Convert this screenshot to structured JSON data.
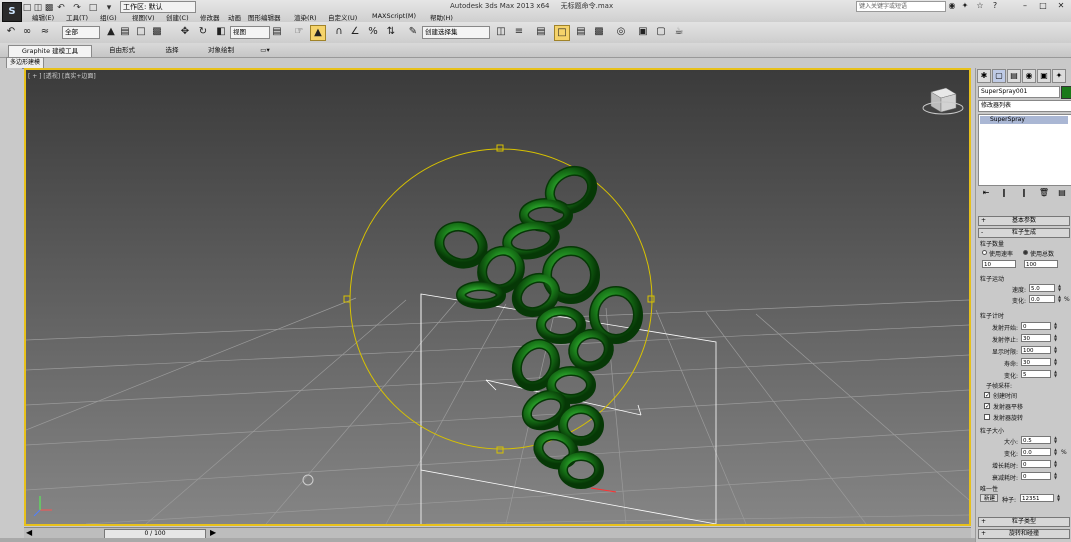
{
  "window": {
    "title": "Autodesk 3ds Max  2013 x64",
    "filename": "无标题命令.max",
    "workspace": "工作区: 默认",
    "search_placeholder": "键入关键字或短语"
  },
  "menu": [
    "编辑(E)",
    "工具(T)",
    "组(G)",
    "视图(V)",
    "创建(C)",
    "修改器",
    "动画",
    "图形编辑器",
    "渲染(R)",
    "自定义(U)",
    "MAXScript(M)",
    "帮助(H)"
  ],
  "toolbar": {
    "filter_dropdown": "全部",
    "coord_dropdown": "视图",
    "selection_set": "创建选择集"
  },
  "ribbon": {
    "tabs": [
      "Graphite 建模工具",
      "自由形式",
      "选择",
      "对象绘制"
    ],
    "subtab": "多边形建模"
  },
  "viewport": {
    "label": "[ + ] [透视] [真实+边面]",
    "object_color": "#1a7a1a"
  },
  "command_panel": {
    "object_name": "SuperSpray001",
    "modifier_list": "修改器列表",
    "stack_item": "SuperSpray",
    "rollouts": {
      "basic": "基本参数",
      "generation": "粒子生成",
      "type": "粒子类型",
      "rotation": "旋转和碰撞"
    },
    "quantity": {
      "group": "粒子数量",
      "use_rate": "使用速率",
      "use_total": "使用总数",
      "rate_value": "10",
      "total_value": "100"
    },
    "motion": {
      "group": "粒子运动",
      "speed_label": "速度:",
      "speed_value": "5.0",
      "variation_label": "变化:",
      "variation_value": "0.0",
      "pct": "%"
    },
    "timing": {
      "group": "粒子计时",
      "emit_start_label": "发射开始:",
      "emit_start": "0",
      "emit_stop_label": "发射停止:",
      "emit_stop": "30",
      "display_until_label": "显示时限:",
      "display_until": "100",
      "life_label": "寿命:",
      "life": "30",
      "variation_label": "变化:",
      "variation": "5"
    },
    "subframe": {
      "group": "子帧采样:",
      "create_time": "创建时间",
      "emitter_translate": "发射器平移",
      "emitter_rotate": "发射器旋转"
    },
    "size": {
      "group": "粒子大小",
      "size_label": "大小:",
      "size_value": "0.5",
      "variation_label": "变化:",
      "variation_value": "0.0",
      "grow_label": "增长耗时:",
      "grow_value": "0",
      "fade_label": "衰减耗时:",
      "fade_value": "0",
      "pct": "%"
    },
    "uniqueness": {
      "group": "唯一性",
      "new_button": "新建",
      "seed_label": "种子:",
      "seed_value": "12351"
    }
  },
  "timeline": {
    "frame": "0 / 100"
  }
}
